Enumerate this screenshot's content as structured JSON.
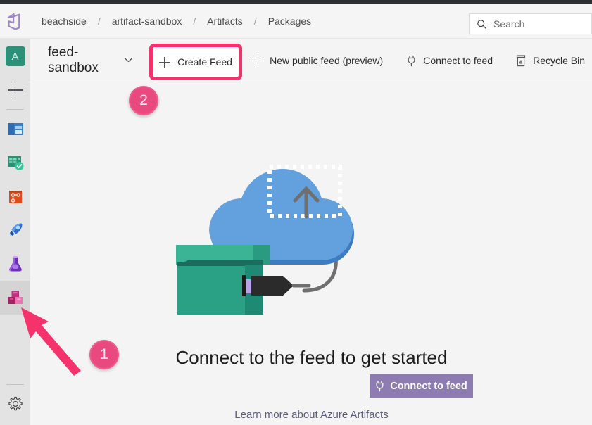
{
  "browser": {
    "top_strip_color": "#2d2f31"
  },
  "global_bar": {
    "logo_name": "azure-devops-logo",
    "breadcrumbs": [
      {
        "label": "beachside"
      },
      {
        "label": "artifact-sandbox"
      },
      {
        "label": "Artifacts"
      },
      {
        "label": "Packages"
      }
    ],
    "separator": "/",
    "search": {
      "placeholder": "Search",
      "value": "",
      "icon": "search-icon"
    }
  },
  "rail": {
    "items": [
      {
        "name": "user-avatar",
        "glyph": "A",
        "type": "avatar",
        "selected": false
      },
      {
        "name": "new-item",
        "glyph": "+",
        "type": "plus",
        "selected": false
      },
      {
        "name": "overview",
        "type": "icon-boards-blue",
        "selected": false
      },
      {
        "name": "boards",
        "type": "icon-boards-green",
        "selected": false
      },
      {
        "name": "repos",
        "type": "icon-repos-orange",
        "selected": false
      },
      {
        "name": "pipelines",
        "type": "icon-pipelines-rocket",
        "selected": false
      },
      {
        "name": "test-plans",
        "type": "icon-testplans-flask",
        "selected": false
      },
      {
        "name": "artifacts",
        "type": "icon-artifacts-boxes",
        "selected": true
      },
      {
        "name": "project-settings",
        "type": "icon-gear",
        "selected": false
      }
    ]
  },
  "header": {
    "feed_name": "feed-sandbox",
    "feed_chevron": "chevron-down-icon",
    "commands": [
      {
        "label": "Create Feed",
        "icon": "plus-icon"
      },
      {
        "label": "New public feed (preview)",
        "icon": "plus-icon"
      },
      {
        "label": "Connect to feed",
        "icon": "plug-icon"
      },
      {
        "label": "Recycle Bin",
        "icon": "recycle-bin-icon"
      }
    ]
  },
  "main": {
    "illustration_name": "cloud-upload-artifacts-illustration",
    "empty_title": "Connect to the feed to get started",
    "connect_button": {
      "label": "Connect to feed",
      "icon": "plug-icon",
      "color": "#8d7cb1"
    },
    "learn_link": "Learn more about Azure Artifacts"
  },
  "annotations": {
    "highlight_color": "#f5326b",
    "badge_color": "#e84a7f",
    "arrow_color": "#f5326b",
    "badges": [
      {
        "id": "1",
        "label": "1",
        "target": "artifacts-rail-item"
      },
      {
        "id": "2",
        "label": "2",
        "target": "create-feed-button"
      }
    ],
    "highlight_box_target": "create-feed-button"
  }
}
